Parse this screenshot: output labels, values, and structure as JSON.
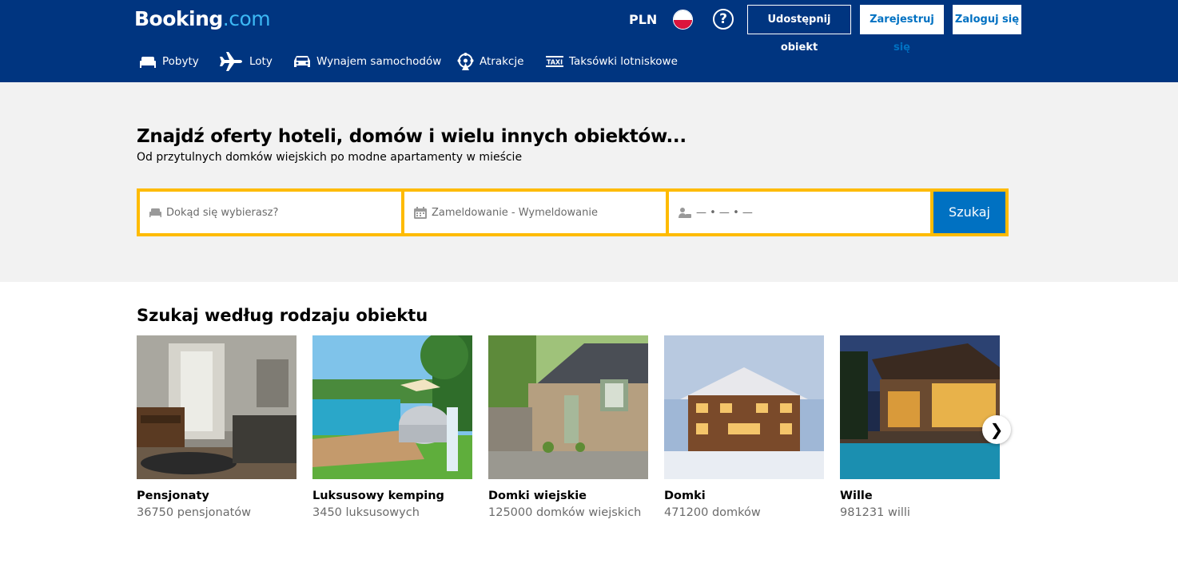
{
  "header": {
    "logo_main": "Booking",
    "logo_tld": ".com",
    "currency": "PLN",
    "help_icon": "question-circle-icon",
    "list_property": "Udostępnij obiekt",
    "register": "Zarejestruj się",
    "login": "Zaloguj się",
    "colors": {
      "bg": "#003580",
      "accent": "#0071c2",
      "tld": "#3cb8f4"
    }
  },
  "nav": [
    {
      "label": "Pobyty",
      "icon": "bed-icon"
    },
    {
      "label": "Loty",
      "icon": "plane-icon"
    },
    {
      "label": "Wynajem samochodów",
      "icon": "car-icon"
    },
    {
      "label": "Atrakcje",
      "icon": "attractions-icon"
    },
    {
      "label": "Taksówki lotniskowe",
      "icon": "taxi-icon"
    }
  ],
  "hero": {
    "title": "Znajdź oferty hoteli, domów i wielu innych obiektów...",
    "subtitle": "Od przytulnych domków wiejskich po modne apartamenty w mieście"
  },
  "search": {
    "destination_placeholder": "Dokąd się wybierasz?",
    "dates_placeholder": "Zameldowanie - Wymeldowanie",
    "guests_placeholder": "— • — • —",
    "button": "Szukaj",
    "colors": {
      "border": "#febb02",
      "button": "#0071c2"
    }
  },
  "property_types": {
    "title": "Szukaj według rodzaju obiektu",
    "cards": [
      {
        "name": "Pensjonaty",
        "count": "36750 pensjonatów"
      },
      {
        "name": "Luksusowy kemping",
        "count": "3450 luksusowych"
      },
      {
        "name": "Domki wiejskie",
        "count": "125000 domków wiejskich"
      },
      {
        "name": "Domki",
        "count": "471200 domków"
      },
      {
        "name": "Wille",
        "count": "981231 willi"
      }
    ],
    "next_arrow": "❯"
  }
}
